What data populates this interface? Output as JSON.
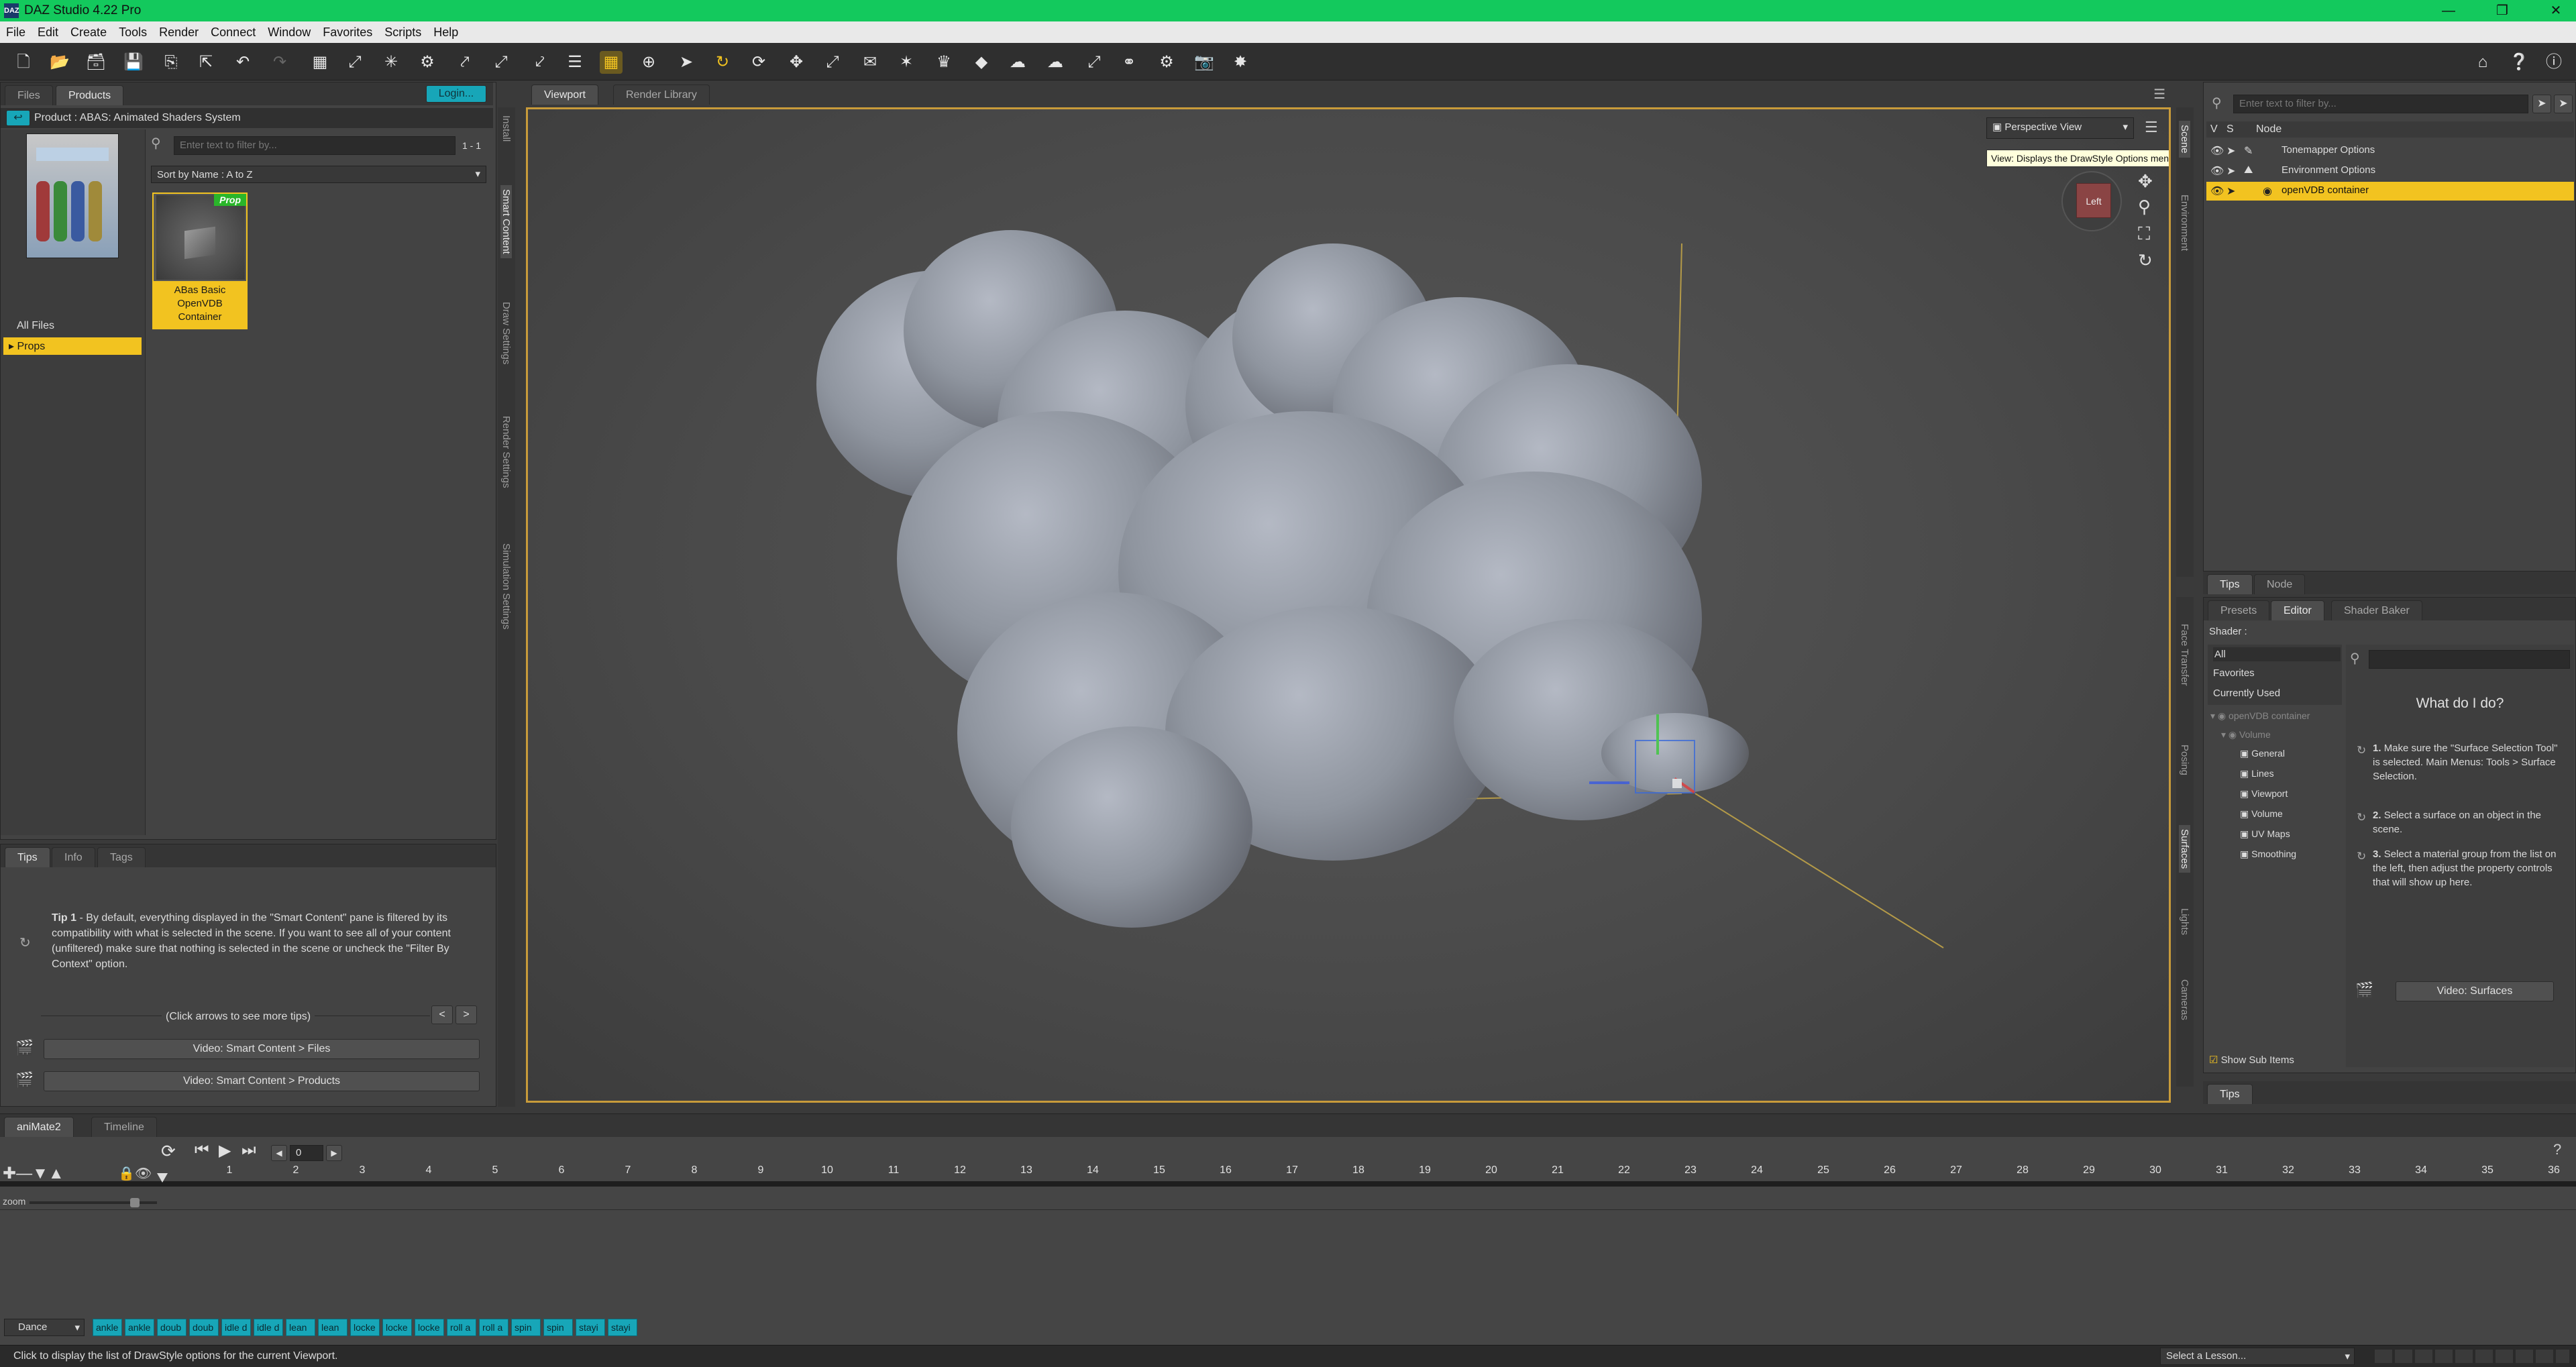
{
  "window": {
    "title": "DAZ Studio 4.22 Pro",
    "logo": "DAZ"
  },
  "menu": [
    "File",
    "Edit",
    "Create",
    "Tools",
    "Render",
    "Connect",
    "Window",
    "Favorites",
    "Scripts",
    "Help"
  ],
  "left": {
    "tabs": [
      "Files",
      "Products"
    ],
    "login": "Login...",
    "product_label": "Product :  ABAS: Animated Shaders System",
    "categories": [
      "All Files",
      "Props"
    ],
    "search_placeholder": "Enter text to filter by...",
    "result_count": "1 - 1",
    "sort": "Sort by Name : A to Z",
    "item": {
      "badge": "Prop",
      "label": "ABas Basic OpenVDB Container"
    },
    "vtabs": [
      "Install",
      "Smart Content",
      "Draw Settings",
      "Render Settings",
      "Simulation Settings"
    ],
    "tips_tabs": [
      "Tips",
      "Info",
      "Tags"
    ],
    "tip_title": "Tip 1",
    "tip_text": " - By default, everything displayed in the \"Smart Content\" pane is filtered by its compatibility with what is selected in the scene. If you want to see all of your content (unfiltered) make sure that nothing is selected in the scene or uncheck the \"Filter By Context\" option.",
    "click_arrows": "(Click arrows to see more tips)",
    "video1": "Video: Smart Content > Files",
    "video2": "Video: Smart Content > Products"
  },
  "viewport": {
    "tabs": [
      "Viewport",
      "Render Library"
    ],
    "view": "Perspective View",
    "cube": "Left"
  },
  "tooltip": "View: Displays the DrawStyle Options menu",
  "right": {
    "search_placeholder": "Enter text to filter by...",
    "cols": [
      "V",
      "S",
      "Node"
    ],
    "nodes": [
      "Tonemapper Options",
      "Environment Options",
      "openVDB container"
    ],
    "vtabs_top": [
      "Scene",
      "Environment"
    ],
    "tabs1": [
      "Tips",
      "Node"
    ],
    "tabs2": [
      "Presets",
      "Editor",
      "Shader Baker"
    ],
    "shader_label": "Shader :",
    "filters": [
      "All",
      "Favorites",
      "Currently Used"
    ],
    "tree_root": "openVDB container",
    "tree_sub": "Volume",
    "tree_items": [
      "General",
      "Lines",
      "Viewport",
      "Volume",
      "UV Maps",
      "Smoothing"
    ],
    "show_sub": "Show Sub Items",
    "vtabs_bottom": [
      "Face Transfer",
      "Posing",
      "Surfaces",
      "Lights",
      "Cameras"
    ],
    "what_title": "What do I do?",
    "steps": [
      {
        "n": "1.",
        "t": "Make sure the \"Surface Selection Tool\" is selected. Main Menus: Tools > Surface Selection."
      },
      {
        "n": "2.",
        "t": "Select a surface on an object in the scene."
      },
      {
        "n": "3.",
        "t": "Select a material group from the list on the left, then adjust the property controls that will show up here."
      }
    ],
    "video": "Video: Surfaces",
    "tips_tab": "Tips"
  },
  "timeline": {
    "tabs": [
      "aniMate2",
      "Timeline"
    ],
    "frame": "0",
    "ticks": [
      "1",
      "2",
      "3",
      "4",
      "5",
      "6",
      "7",
      "8",
      "9",
      "10",
      "11",
      "12",
      "13",
      "14",
      "15",
      "16",
      "17",
      "18",
      "19",
      "20",
      "21",
      "22",
      "23",
      "24",
      "25",
      "26",
      "27",
      "28",
      "29",
      "30",
      "31",
      "32",
      "33",
      "34",
      "35",
      "36"
    ],
    "zoom": "zoom",
    "preset": "Dance",
    "aniblocks": [
      "ankle",
      "ankle",
      "doub",
      "doub",
      "idle d",
      "idle d",
      "lean",
      "lean",
      "locke",
      "locke",
      "locke",
      "roll a",
      "roll a",
      "spin",
      "spin",
      "stayi",
      "stayi"
    ]
  },
  "status": {
    "text": "Click to display the list of DrawStyle options for the current Viewport.",
    "lesson": "Select a Lesson..."
  }
}
